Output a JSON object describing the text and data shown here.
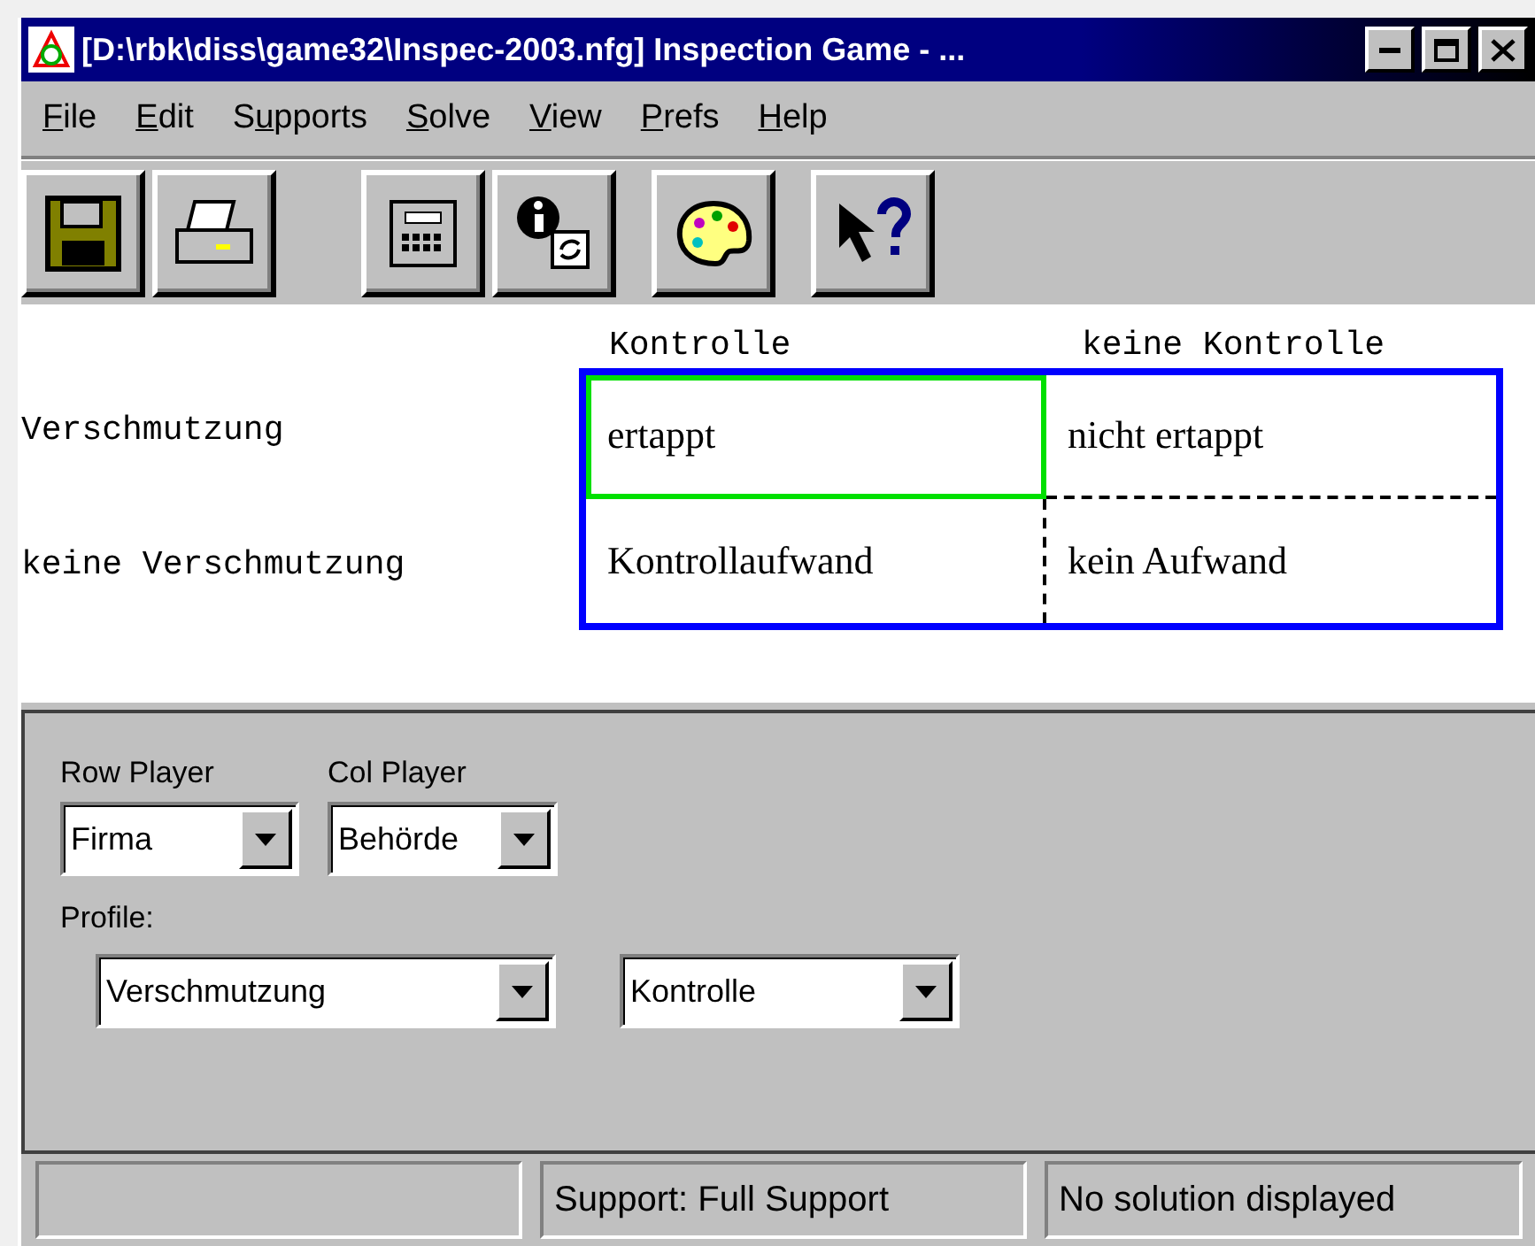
{
  "window": {
    "title": "[D:\\rbk\\diss\\game32\\Inspec-2003.nfg] Inspection Game -  ..."
  },
  "menu": [
    {
      "label": "File"
    },
    {
      "label": "Edit"
    },
    {
      "label": "Supports"
    },
    {
      "label": "Solve"
    },
    {
      "label": "View"
    },
    {
      "label": "Prefs"
    },
    {
      "label": "Help"
    }
  ],
  "toolbar": [
    {
      "kind": "save"
    },
    {
      "kind": "print"
    },
    {
      "kind": "calculator"
    },
    {
      "kind": "info"
    },
    {
      "kind": "palette"
    },
    {
      "kind": "help"
    }
  ],
  "matrix": {
    "columns": [
      "Kontrolle",
      "keine Kontrolle"
    ],
    "rows": [
      {
        "label": "Verschmutzung",
        "cells": [
          {
            "text": "ertappt",
            "selected": true
          },
          {
            "text": "nicht ertappt",
            "selected": false
          }
        ]
      },
      {
        "label": "keine Verschmutzung",
        "cells": [
          {
            "text": "Kontrollaufwand",
            "selected": false
          },
          {
            "text": "kein Aufwand",
            "selected": false
          }
        ]
      }
    ]
  },
  "players": [
    {
      "label": "Row Player",
      "value": "Firma"
    },
    {
      "label": "Col Player",
      "value": "Behörde"
    }
  ],
  "profile": {
    "label": "Profile:",
    "values": [
      "Verschmutzung",
      "Kontrolle"
    ]
  },
  "status_bar": [
    "Support: Full Support",
    "No solution displayed"
  ]
}
